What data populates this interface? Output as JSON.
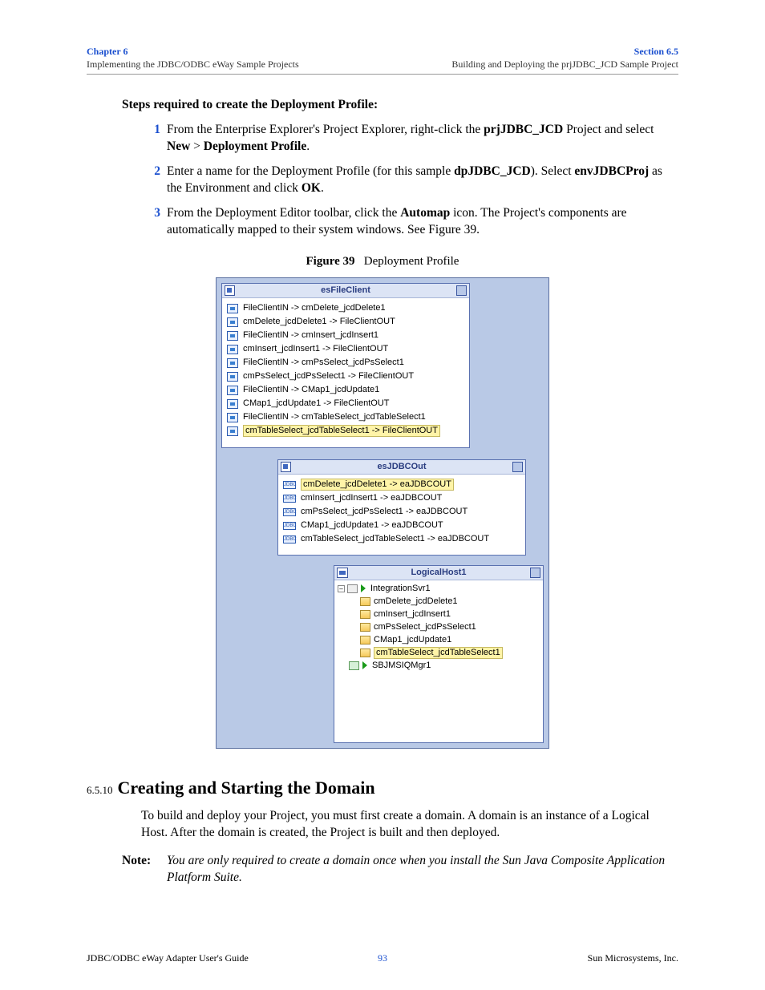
{
  "header": {
    "chapter": "Chapter 6",
    "chapter_sub": "Implementing the JDBC/ODBC eWay Sample Projects",
    "section": "Section 6.5",
    "section_sub": "Building and Deploying the prjJDBC_JCD Sample Project"
  },
  "steps_title": "Steps required to create the Deployment Profile:",
  "steps": [
    {
      "num": "1",
      "parts": [
        "From the Enterprise Explorer's Project Explorer, right-click the ",
        "prjJDBC_JCD",
        " Project and select ",
        "New",
        " > ",
        "Deployment Profile",
        "."
      ]
    },
    {
      "num": "2",
      "parts": [
        "Enter a name for the Deployment Profile (for this sample ",
        "dpJDBC_JCD",
        "). Select ",
        "envJDBCProj",
        " as the Environment and click ",
        "OK",
        "."
      ]
    },
    {
      "num": "3",
      "parts": [
        "From the Deployment Editor toolbar, click the ",
        "Automap",
        " icon. The Project's components are automatically mapped to their system windows. See Figure 39."
      ]
    }
  ],
  "figure": {
    "label": "Figure 39",
    "caption": "Deployment Profile",
    "panel1": {
      "title": "esFileClient",
      "rows": [
        "FileClientIN -> cmDelete_jcdDelete1",
        "cmDelete_jcdDelete1 -> FileClientOUT",
        "FileClientIN -> cmInsert_jcdInsert1",
        "cmInsert_jcdInsert1 -> FileClientOUT",
        "FileClientIN -> cmPsSelect_jcdPsSelect1",
        "cmPsSelect_jcdPsSelect1 -> FileClientOUT",
        "FileClientIN -> CMap1_jcdUpdate1",
        "CMap1_jcdUpdate1 -> FileClientOUT",
        "FileClientIN -> cmTableSelect_jcdTableSelect1"
      ],
      "highlighted": "cmTableSelect_jcdTableSelect1 -> FileClientOUT"
    },
    "panel2": {
      "title": "esJDBCOut",
      "highlighted": "cmDelete_jcdDelete1 -> eaJDBCOUT",
      "rows": [
        "cmInsert_jcdInsert1 -> eaJDBCOUT",
        "cmPsSelect_jcdPsSelect1 -> eaJDBCOUT",
        "CMap1_jcdUpdate1 -> eaJDBCOUT",
        "cmTableSelect_jcdTableSelect1 -> eaJDBCOUT"
      ]
    },
    "panel3": {
      "title": "LogicalHost1",
      "root": "IntegrationSvr1",
      "children": [
        "cmDelete_jcdDelete1",
        "cmInsert_jcdInsert1",
        "cmPsSelect_jcdPsSelect1",
        "CMap1_jcdUpdate1"
      ],
      "highlighted_child": "cmTableSelect_jcdTableSelect1",
      "sibling": "SBJMSIQMgr1"
    }
  },
  "section": {
    "num": "6.5.10",
    "title": "Creating and Starting the Domain",
    "para": "To build and deploy your Project, you must first create a domain. A domain is an instance of a Logical Host. After the domain is created, the Project is built and then deployed."
  },
  "note": {
    "label": "Note:",
    "body": "You are only required to create a domain once when you install the Sun Java Composite Application Platform Suite."
  },
  "footer": {
    "left": "JDBC/ODBC eWay Adapter User's Guide",
    "page": "93",
    "right": "Sun Microsystems, Inc."
  }
}
